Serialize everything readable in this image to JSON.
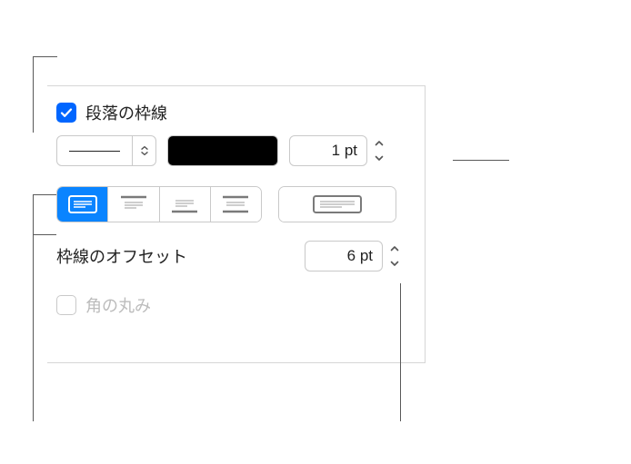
{
  "checkbox": {
    "paragraph_borders_label": "段落の枠線",
    "rounded_corners_label": "角の丸み"
  },
  "line_weight": {
    "value": "1 pt"
  },
  "offset": {
    "label": "枠線のオフセット",
    "value": "6 pt"
  }
}
